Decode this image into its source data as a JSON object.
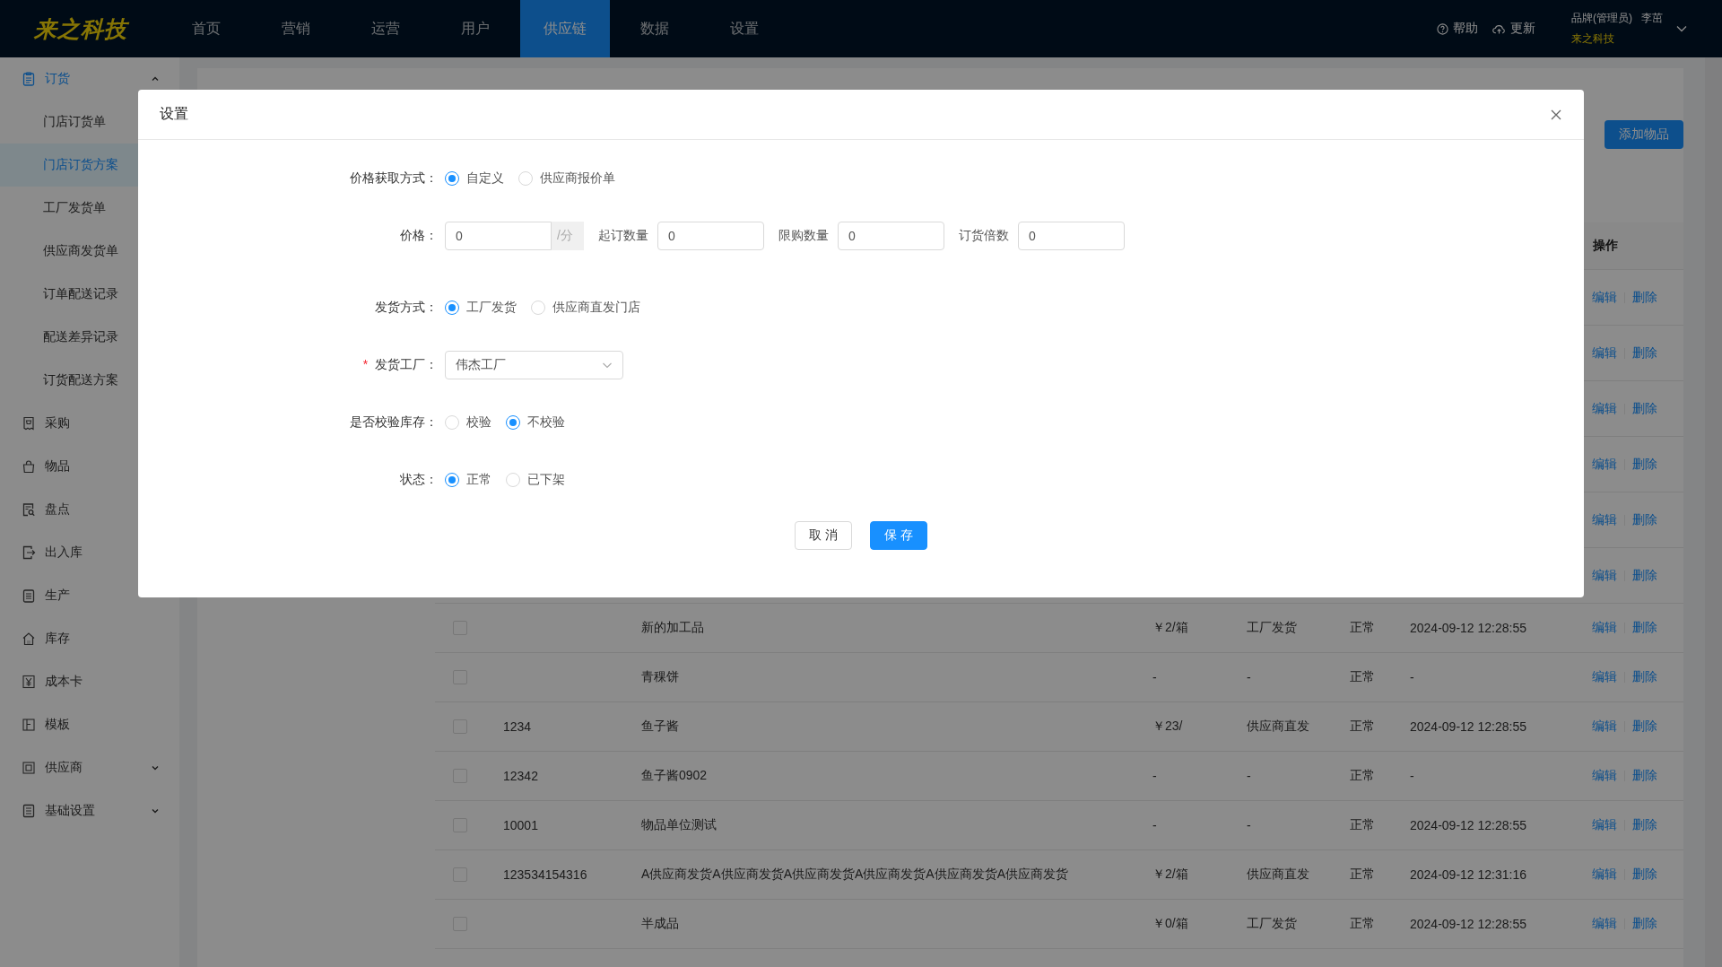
{
  "brand": {
    "logo": "来之科技"
  },
  "nav": [
    {
      "label": "首页",
      "selected": false
    },
    {
      "label": "营销",
      "selected": false
    },
    {
      "label": "运营",
      "selected": false
    },
    {
      "label": "用户",
      "selected": false
    },
    {
      "label": "供应链",
      "selected": true
    },
    {
      "label": "数据",
      "selected": false
    },
    {
      "label": "设置",
      "selected": false
    }
  ],
  "header_actions": [
    {
      "kind": "help",
      "label": "帮助"
    },
    {
      "kind": "update",
      "label": "更新"
    }
  ],
  "user": {
    "role": "品牌(管理员)",
    "name": "李茁",
    "company": "来之科技"
  },
  "sidebar": {
    "items": [
      {
        "label": "订货",
        "expanded": true,
        "children": [
          {
            "label": "门店订货单",
            "selected": false
          },
          {
            "label": "门店订货方案",
            "selected": true
          },
          {
            "label": "工厂发货单",
            "selected": false
          },
          {
            "label": "供应商发货单",
            "selected": false
          },
          {
            "label": "订单配送记录",
            "selected": false
          },
          {
            "label": "配送差异记录",
            "selected": false
          },
          {
            "label": "订货配送方案",
            "selected": false
          }
        ]
      },
      {
        "label": "采购"
      },
      {
        "label": "物品"
      },
      {
        "label": "盘点"
      },
      {
        "label": "出入库"
      },
      {
        "label": "生产"
      },
      {
        "label": "库存"
      },
      {
        "label": "成本卡"
      },
      {
        "label": "模板"
      },
      {
        "label": "供应商",
        "expanded": false
      },
      {
        "label": "基础设置",
        "expanded": false
      }
    ]
  },
  "toolbar": {
    "add_button": "添加物品"
  },
  "table": {
    "action_column": "操作",
    "rows": [
      {
        "actions": [
          "编辑",
          "删除"
        ]
      },
      {
        "actions": [
          "编辑",
          "删除"
        ]
      },
      {
        "actions": [
          "编辑",
          "删除"
        ]
      },
      {
        "actions": [
          "编辑",
          "删除"
        ]
      },
      {
        "actions": [
          "编辑",
          "删除"
        ]
      },
      {
        "actions": [
          "编辑",
          "删除"
        ]
      },
      {
        "checked": false,
        "name": "新的加工品",
        "price": "￥2/箱",
        "delivery": "工厂发货",
        "status": "正常",
        "time": "2024-09-12 12:28:55",
        "actions": [
          "编辑",
          "删除"
        ]
      },
      {
        "checked": false,
        "name": "青稞饼",
        "price": "-",
        "delivery": "-",
        "status": "正常",
        "time": "-",
        "actions": [
          "编辑",
          "删除"
        ]
      },
      {
        "checked": false,
        "code": "1234",
        "name": "鱼子酱",
        "price": "￥23/",
        "delivery": "供应商直发",
        "status": "正常",
        "time": "2024-09-12 12:28:55",
        "actions": [
          "编辑",
          "删除"
        ]
      },
      {
        "checked": false,
        "code": "12342",
        "name": "鱼子酱0902",
        "price": "-",
        "delivery": "-",
        "status": "正常",
        "time": "-",
        "actions": [
          "编辑",
          "删除"
        ]
      },
      {
        "checked": false,
        "code": "10001",
        "name": "物品单位测试",
        "price": "-",
        "delivery": "-",
        "status": "正常",
        "time": "2024-09-12 12:28:55",
        "actions": [
          "编辑",
          "删除"
        ]
      },
      {
        "checked": false,
        "code": "123534154316",
        "name": "A供应商发货A供应商发货A供应商发货A供应商发货A供应商发货A供应商发货",
        "price": "￥2/箱",
        "delivery": "供应商直发",
        "status": "正常",
        "time": "2024-09-12 12:31:16",
        "actions": [
          "编辑",
          "删除"
        ]
      },
      {
        "checked": false,
        "name": "半成品",
        "price": "￥0/箱",
        "delivery": "工厂发货",
        "status": "正常",
        "time": "2024-09-12 12:28:55",
        "actions": [
          "编辑",
          "删除"
        ]
      }
    ]
  },
  "dialog": {
    "title": "设置",
    "fields": [
      {
        "kind": "radio",
        "label": "价格获取方式：",
        "options": [
          {
            "label": "自定义",
            "selected": true
          },
          {
            "label": "供应商报价单",
            "selected": false
          }
        ]
      },
      {
        "kind": "inputs",
        "label": "价格：",
        "items": [
          {
            "value": "0",
            "suffix": "/分"
          },
          {
            "label": "起订数量",
            "value": "0"
          },
          {
            "label": "限购数量",
            "value": "0"
          },
          {
            "label": "订货倍数",
            "value": "0"
          }
        ]
      },
      {
        "kind": "radio",
        "label": "发货方式：",
        "options": [
          {
            "label": "工厂发货",
            "selected": true
          },
          {
            "label": "供应商直发门店",
            "selected": false
          }
        ]
      },
      {
        "kind": "select",
        "label": "发货工厂：",
        "required_mark": "*",
        "value": "伟杰工厂"
      },
      {
        "kind": "radio",
        "label": "是否校验库存：",
        "options": [
          {
            "label": "校验",
            "selected": false
          },
          {
            "label": "不校验",
            "selected": true
          }
        ]
      },
      {
        "kind": "radio",
        "label": "状态：",
        "options": [
          {
            "label": "正常",
            "selected": true
          },
          {
            "label": "已下架",
            "selected": false
          }
        ]
      }
    ],
    "buttons": [
      {
        "kind": "default",
        "label": "取 消"
      },
      {
        "kind": "primary",
        "label": "保 存"
      }
    ]
  }
}
